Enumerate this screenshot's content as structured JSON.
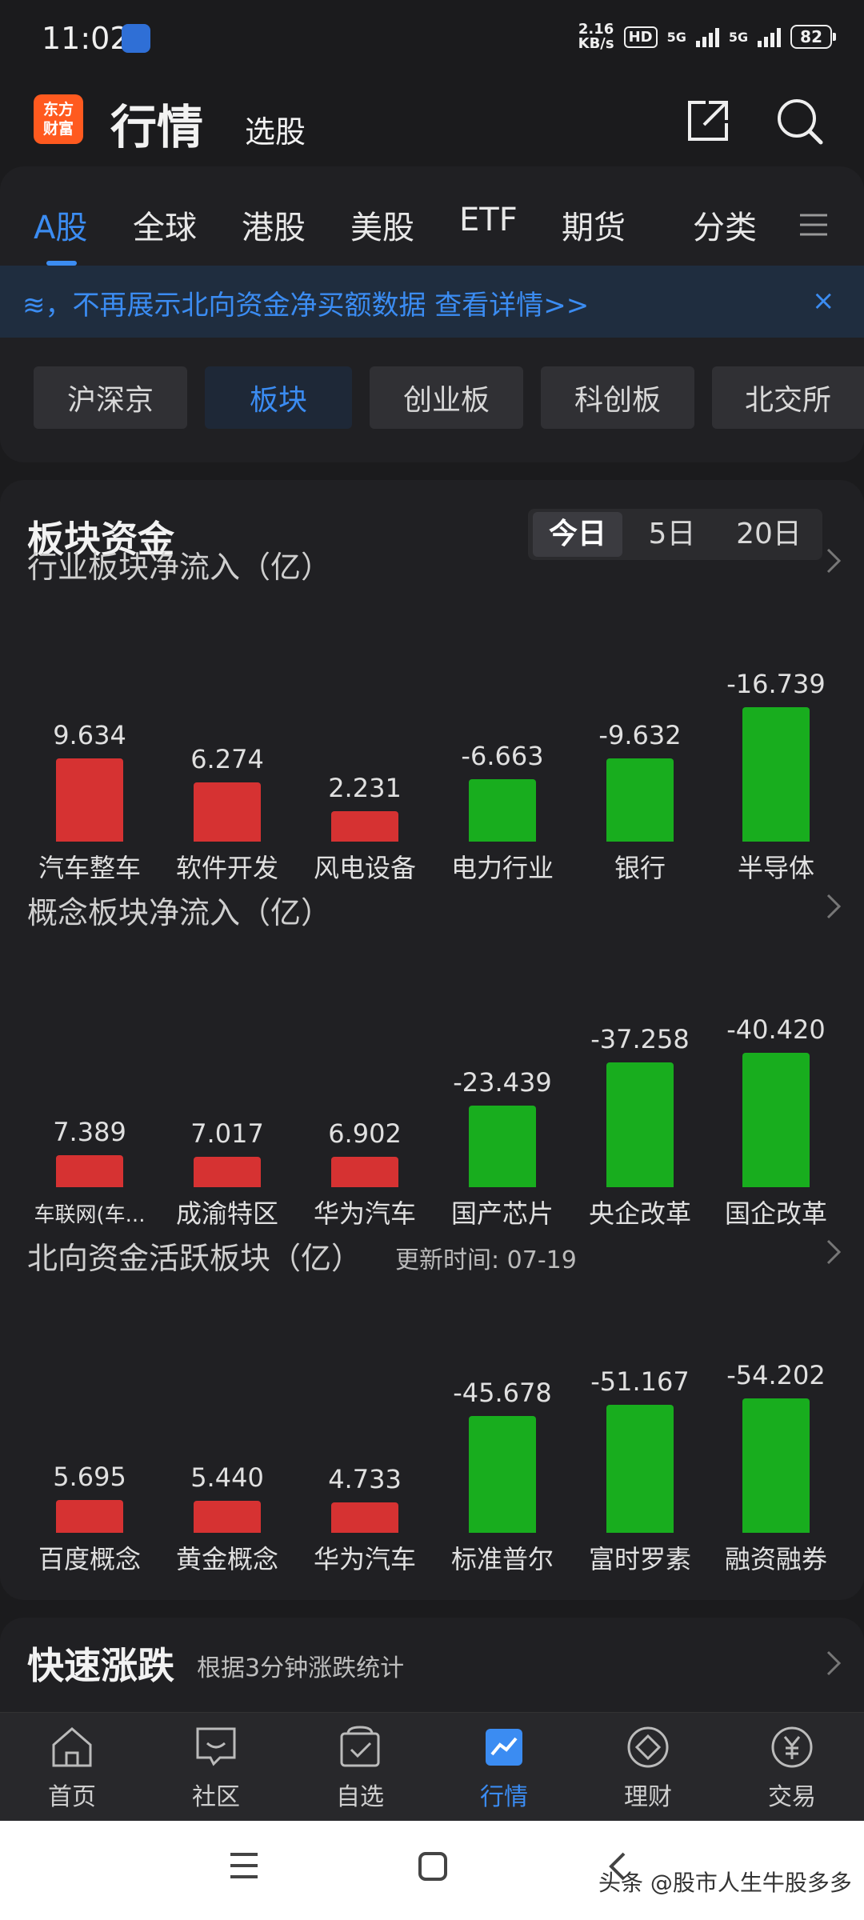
{
  "status_bar": {
    "time": "11:02",
    "net_speed_value": "2.16",
    "net_speed_unit": "KB/s",
    "hd": "HD",
    "sim1": "5G",
    "sim2": "5G",
    "battery": "82"
  },
  "header": {
    "logo_line1": "东方",
    "logo_line2": "财富",
    "title": "行情",
    "subtitle": "选股"
  },
  "tabs": [
    {
      "label": "A股",
      "active": true
    },
    {
      "label": "全球"
    },
    {
      "label": "港股"
    },
    {
      "label": "美股"
    },
    {
      "label": "ETF"
    },
    {
      "label": "期货"
    },
    {
      "label": "分类"
    }
  ],
  "banner": {
    "text": "≋，不再展示北向资金净买额数据 查看详情>>",
    "close": "×"
  },
  "chips": [
    {
      "label": "沪深京"
    },
    {
      "label": "板块",
      "active": true
    },
    {
      "label": "创业板"
    },
    {
      "label": "科创板"
    },
    {
      "label": "北交所"
    }
  ],
  "card": {
    "title": "板块资金",
    "periods": [
      "今日",
      "5日",
      "20日"
    ],
    "active_period": "今日"
  },
  "sections": [
    {
      "title": "行业板块净流入（亿）",
      "time": "",
      "bars": [
        {
          "label": "汽车整车",
          "value": "9.634"
        },
        {
          "label": "软件开发",
          "value": "6.274"
        },
        {
          "label": "风电设备",
          "value": "2.231"
        },
        {
          "label": "电力行业",
          "value": "-6.663"
        },
        {
          "label": "银行",
          "value": "-9.632"
        },
        {
          "label": "半导体",
          "value": "-16.739"
        }
      ]
    },
    {
      "title": "概念板块净流入（亿）",
      "time": "",
      "bars": [
        {
          "label": "车联网(车...",
          "value": "7.389"
        },
        {
          "label": "成渝特区",
          "value": "7.017"
        },
        {
          "label": "华为汽车",
          "value": "6.902"
        },
        {
          "label": "国产芯片",
          "value": "-23.439"
        },
        {
          "label": "央企改革",
          "value": "-37.258"
        },
        {
          "label": "国企改革",
          "value": "-40.420"
        }
      ]
    },
    {
      "title": "北向资金活跃板块（亿）",
      "time": "更新时间: 07-19",
      "bars": [
        {
          "label": "百度概念",
          "value": "5.695"
        },
        {
          "label": "黄金概念",
          "value": "5.440"
        },
        {
          "label": "华为汽车",
          "value": "4.733"
        },
        {
          "label": "标准普尔",
          "value": "-45.678"
        },
        {
          "label": "富时罗素",
          "value": "-51.167"
        },
        {
          "label": "融资融券",
          "value": "-54.202"
        }
      ]
    }
  ],
  "quick": {
    "title": "快速涨跌",
    "subtitle": "根据3分钟涨跌统计"
  },
  "bottom_nav": [
    {
      "label": "首页",
      "icon": "home-icon"
    },
    {
      "label": "社区",
      "icon": "community-icon"
    },
    {
      "label": "自选",
      "icon": "watchlist-icon"
    },
    {
      "label": "行情",
      "icon": "market-icon",
      "active": true
    },
    {
      "label": "理财",
      "icon": "wealth-icon"
    },
    {
      "label": "交易",
      "icon": "trade-icon"
    }
  ],
  "watermark": "头条 @股市人生牛股多多",
  "colors": {
    "accent": "#3b8cf2",
    "inflow": "#d63232",
    "outflow": "#18ad1e",
    "background": "#1b1b1d"
  }
}
